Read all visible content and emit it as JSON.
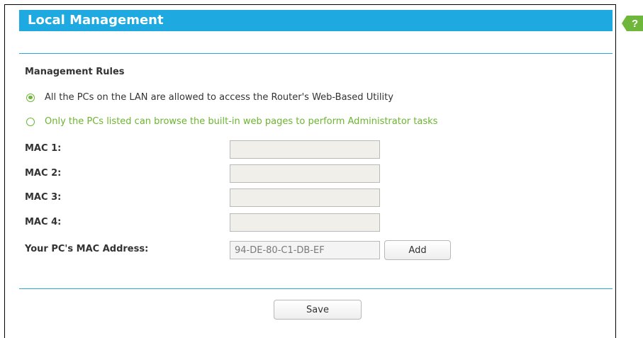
{
  "page": {
    "title": "Local Management",
    "help_icon_glyph": "?"
  },
  "rules": {
    "section_title": "Management Rules",
    "option_all": "All the PCs on the LAN are allowed to access the Router's Web-Based Utility",
    "option_listed": "Only the PCs listed can browse the built-in web pages to perform Administrator tasks",
    "selected": "all"
  },
  "mac_fields": [
    {
      "label": "MAC 1:",
      "value": ""
    },
    {
      "label": "MAC 2:",
      "value": ""
    },
    {
      "label": "MAC 3:",
      "value": ""
    },
    {
      "label": "MAC 4:",
      "value": ""
    }
  ],
  "pc_mac": {
    "label": "Your PC's MAC Address:",
    "value": "94-DE-80-C1-DB-EF",
    "add_label": "Add"
  },
  "buttons": {
    "save_label": "Save"
  },
  "colors": {
    "title_bar": "#1fa9e1",
    "accent_green": "#6cb52f",
    "divider": "#2ba5dc"
  },
  "icons": {
    "help": "help-icon",
    "radio_checked": "radio-checked-icon",
    "radio_unchecked": "radio-unchecked-icon"
  }
}
